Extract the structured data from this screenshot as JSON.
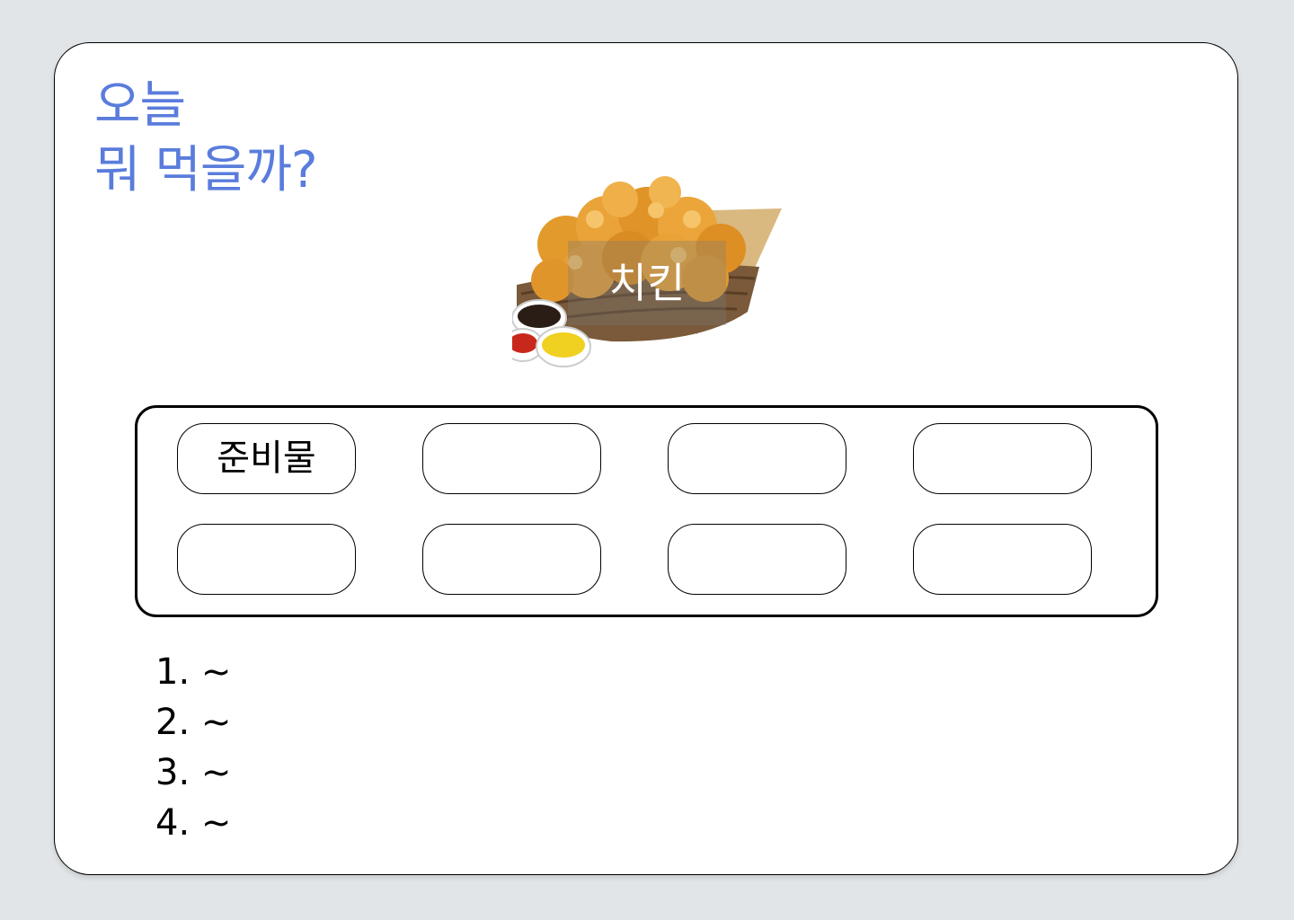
{
  "title": {
    "line1": "오늘",
    "line2": "뭐 먹을까?"
  },
  "menu": {
    "name": "치킨",
    "image": "fried-chicken-basket"
  },
  "ingredients": {
    "slots": [
      "준비물",
      "",
      "",
      "",
      "",
      "",
      "",
      ""
    ]
  },
  "steps": [
    {
      "num": "1.",
      "text": "~"
    },
    {
      "num": "2.",
      "text": "~"
    },
    {
      "num": "3.",
      "text": "~"
    },
    {
      "num": "4.",
      "text": "~"
    }
  ],
  "colors": {
    "accent": "#5a7cdc",
    "background": "#e1e5e7",
    "card": "#ffffff"
  }
}
